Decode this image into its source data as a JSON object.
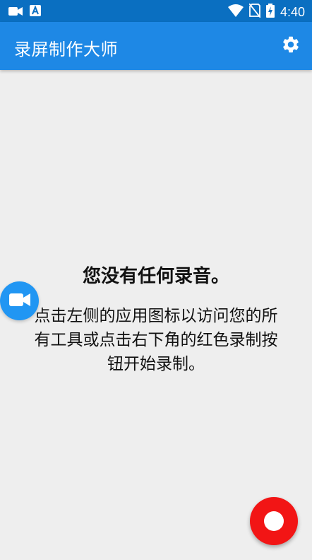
{
  "status_bar": {
    "time": "4:40",
    "left_icons": [
      "video-camera-icon",
      "text-a-icon"
    ],
    "right_icons": [
      "wifi-icon",
      "no-sim-icon",
      "battery-charging-icon"
    ]
  },
  "app_bar": {
    "title": "录屏制作大师",
    "settings_icon": "gear-icon"
  },
  "empty_state": {
    "title": "您没有任何录音。",
    "description": "点击左侧的应用图标以访问您的所有工具或点击右下角的红色录制按钮开始录制。"
  },
  "colors": {
    "status_bar": "#0a6fc1",
    "app_bar": "#1e88e5",
    "background": "#eeeeee",
    "side_button": "#2196f3",
    "record_button": "#f21515"
  },
  "side_button": {
    "icon": "video-camera-icon"
  },
  "record_button": {
    "icon": "record-dot-icon"
  }
}
